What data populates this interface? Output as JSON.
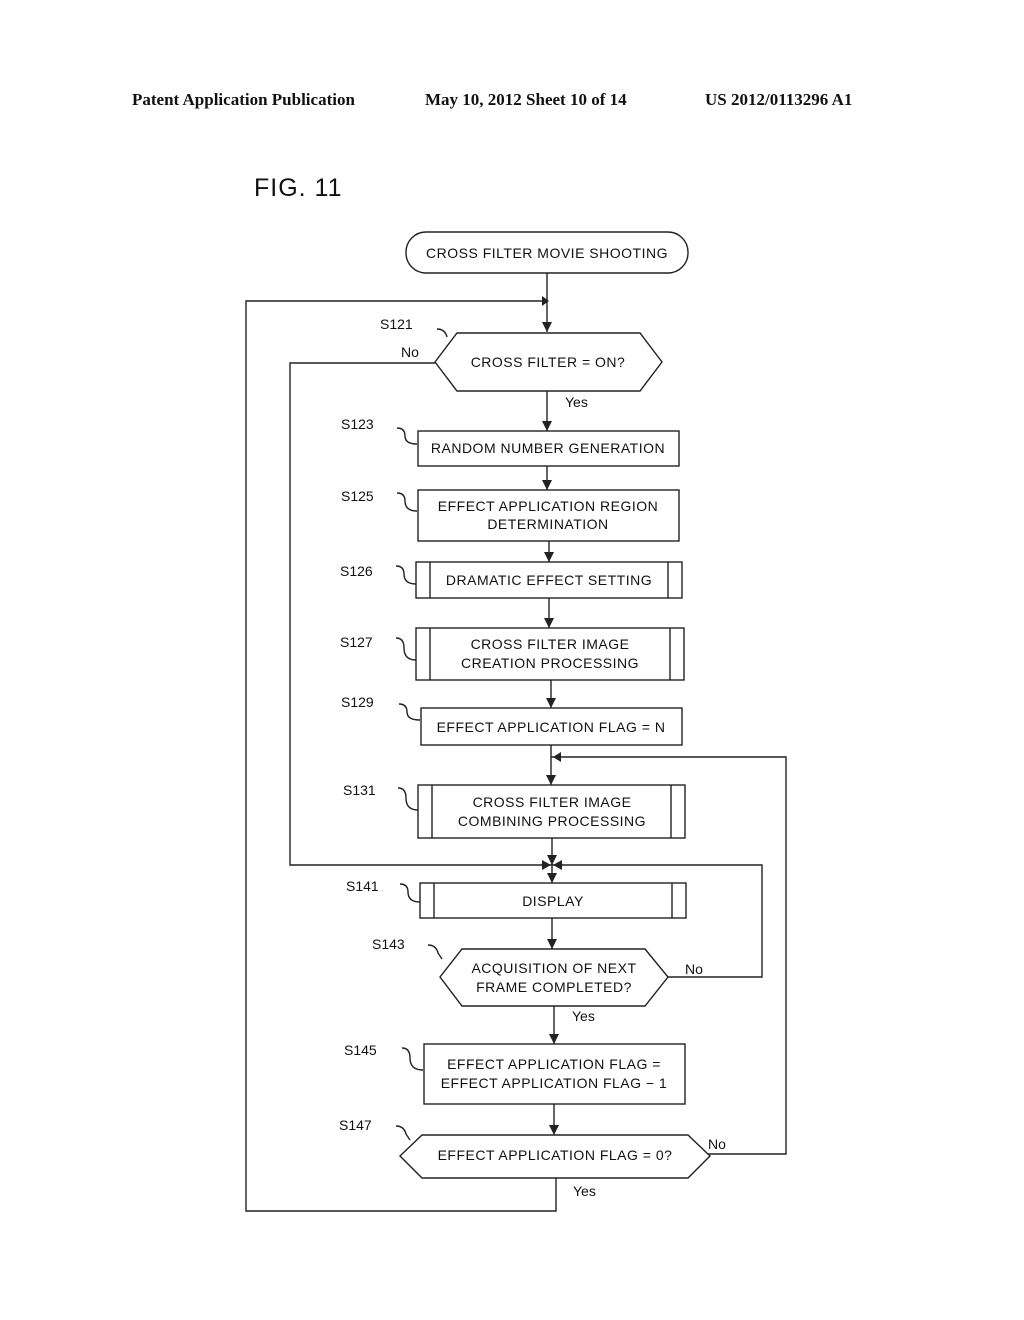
{
  "header": {
    "publication": "Patent Application Publication",
    "date_sheet": "May 10, 2012  Sheet 10 of 14",
    "number": "US 2012/0113296 A1"
  },
  "figure": {
    "title": "FIG. 11",
    "start": "CROSS FILTER MOVIE SHOOTING",
    "steps": {
      "s121": {
        "id": "S121",
        "lines": [
          "CROSS FILTER  = ON?"
        ]
      },
      "s123": {
        "id": "S123",
        "lines": [
          "RANDOM NUMBER GENERATION"
        ]
      },
      "s125": {
        "id": "S125",
        "lines": [
          "EFFECT APPLICATION REGION",
          "DETERMINATION"
        ]
      },
      "s126": {
        "id": "S126",
        "lines": [
          "DRAMATIC EFFECT SETTING"
        ]
      },
      "s127": {
        "id": "S127",
        "lines": [
          "CROSS FILTER IMAGE",
          "CREATION PROCESSING"
        ]
      },
      "s129": {
        "id": "S129",
        "lines": [
          "EFFECT APPLICATION FLAG = N"
        ]
      },
      "s131": {
        "id": "S131",
        "lines": [
          "CROSS FILTER IMAGE",
          "COMBINING PROCESSING"
        ]
      },
      "s141": {
        "id": "S141",
        "lines": [
          "DISPLAY"
        ]
      },
      "s143": {
        "id": "S143",
        "lines": [
          "ACQUISITION OF NEXT",
          "FRAME COMPLETED?"
        ]
      },
      "s145": {
        "id": "S145",
        "lines": [
          "EFFECT APPLICATION FLAG =",
          "EFFECT APPLICATION FLAG − 1"
        ]
      },
      "s147": {
        "id": "S147",
        "lines": [
          "EFFECT APPLICATION FLAG = 0?"
        ]
      }
    },
    "branches": {
      "s121_no": "No",
      "s121_yes": "Yes",
      "s143_no": "No",
      "s143_yes": "Yes",
      "s147_no": "No",
      "s147_yes": "Yes"
    }
  }
}
